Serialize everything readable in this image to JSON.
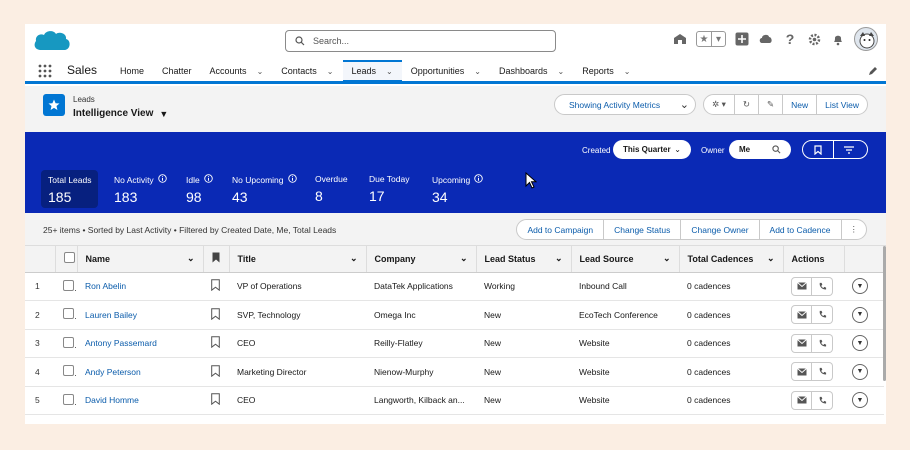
{
  "search": {
    "placeholder": "Search..."
  },
  "nav": {
    "app_name": "Sales",
    "items": [
      {
        "label": "Home",
        "chev": false
      },
      {
        "label": "Chatter",
        "chev": false
      },
      {
        "label": "Accounts",
        "chev": true
      },
      {
        "label": "Contacts",
        "chev": true
      },
      {
        "label": "Leads",
        "chev": true,
        "active": true
      },
      {
        "label": "Opportunities",
        "chev": true
      },
      {
        "label": "Dashboards",
        "chev": true
      },
      {
        "label": "Reports",
        "chev": true
      }
    ]
  },
  "header": {
    "object_label": "Leads",
    "view_title": "Intelligence View",
    "activity_btn": "Showing Activity Metrics",
    "new_btn": "New",
    "list_view_btn": "List View"
  },
  "band": {
    "created_label": "Created",
    "created_value": "This Quarter",
    "owner_label": "Owner",
    "owner_value": "Me",
    "metrics": [
      {
        "label": "Total Leads",
        "value": "185",
        "info": false
      },
      {
        "label": "No Activity",
        "value": "183",
        "info": true
      },
      {
        "label": "Idle",
        "value": "98",
        "info": true
      },
      {
        "label": "No Upcoming",
        "value": "43",
        "info": true
      },
      {
        "label": "Overdue",
        "value": "8",
        "info": false
      },
      {
        "label": "Due Today",
        "value": "17",
        "info": false
      },
      {
        "label": "Upcoming",
        "value": "34",
        "info": true
      }
    ]
  },
  "listbar": {
    "info": "25+ items • Sorted by Last Activity • Filtered by Created Date, Me, Total Leads",
    "actions": [
      "Add to Campaign",
      "Change Status",
      "Change Owner",
      "Add to Cadence"
    ]
  },
  "table": {
    "columns": [
      "Name",
      "Title",
      "Company",
      "Lead Status",
      "Lead Source",
      "Total Cadences",
      "Actions"
    ],
    "rows": [
      {
        "n": "1",
        "name": "Ron Abelin",
        "title": "VP of Operations",
        "company": "DataTek Applications",
        "status": "Working",
        "source": "Inbound Call",
        "cadences": "0 cadences"
      },
      {
        "n": "2",
        "name": "Lauren Bailey",
        "title": "SVP, Technology",
        "company": "Omega Inc",
        "status": "New",
        "source": "EcoTech Conference",
        "cadences": "0 cadences"
      },
      {
        "n": "3",
        "name": "Antony Passemard",
        "title": "CEO",
        "company": "Reilly-Flatley",
        "status": "New",
        "source": "Website",
        "cadences": "0 cadences"
      },
      {
        "n": "4",
        "name": "Andy Peterson",
        "title": "Marketing Director",
        "company": "Nienow-Murphy",
        "status": "New",
        "source": "Website",
        "cadences": "0 cadences"
      },
      {
        "n": "5",
        "name": "David Homme",
        "title": "CEO",
        "company": "Langworth, Kilback an...",
        "status": "New",
        "source": "Website",
        "cadences": "0 cadences"
      }
    ]
  }
}
